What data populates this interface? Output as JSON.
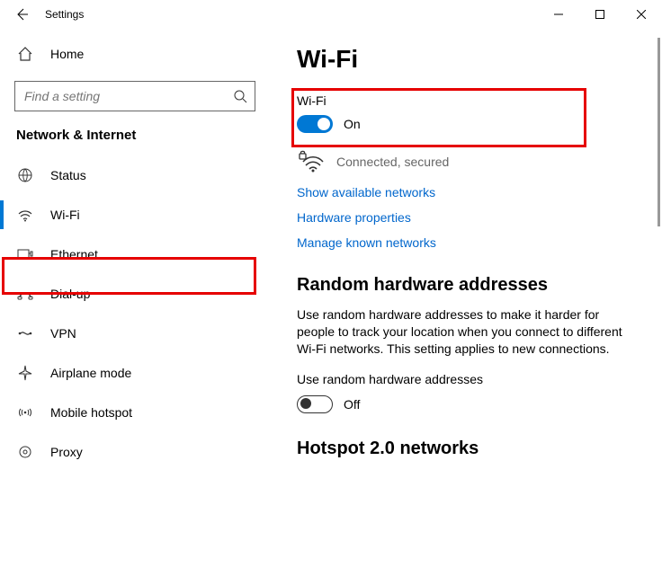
{
  "window": {
    "title": "Settings"
  },
  "sidebar": {
    "home_label": "Home",
    "search_placeholder": "Find a setting",
    "section_heading": "Network & Internet",
    "items": [
      {
        "label": "Status"
      },
      {
        "label": "Wi-Fi"
      },
      {
        "label": "Ethernet"
      },
      {
        "label": "Dial-up"
      },
      {
        "label": "VPN"
      },
      {
        "label": "Airplane mode"
      },
      {
        "label": "Mobile hotspot"
      },
      {
        "label": "Proxy"
      }
    ]
  },
  "content": {
    "page_title": "Wi-Fi",
    "wifi": {
      "label": "Wi-Fi",
      "state_label": "On"
    },
    "status_text": "Connected, secured",
    "links": {
      "show_networks": "Show available networks",
      "hardware_props": "Hardware properties",
      "manage_known": "Manage known networks"
    },
    "random": {
      "heading": "Random hardware addresses",
      "desc": "Use random hardware addresses to make it harder for people to track your location when you connect to different Wi-Fi networks. This setting applies to new connections.",
      "toggle_label": "Use random hardware addresses",
      "state_label": "Off"
    },
    "hotspot_heading": "Hotspot 2.0 networks"
  }
}
